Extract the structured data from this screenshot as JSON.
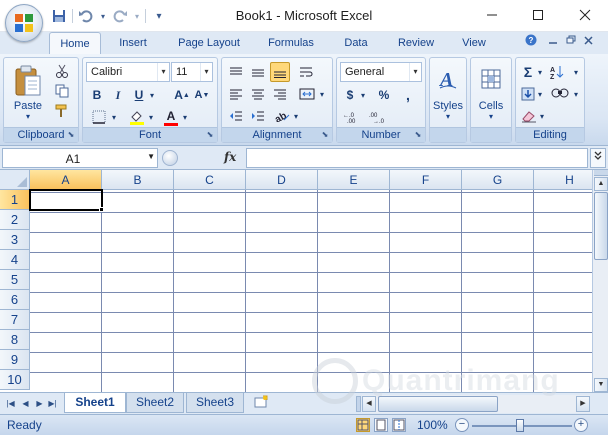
{
  "window": {
    "title": "Book1 - Microsoft Excel",
    "minimize_glyph": "—",
    "maximize_glyph": "☐",
    "close_glyph": "✕"
  },
  "quick_access": {
    "save_glyph": "💾",
    "undo_glyph": "↶",
    "redo_glyph": "↷",
    "customize_glyph": "▾"
  },
  "tabs": [
    "Home",
    "Insert",
    "Page Layout",
    "Formulas",
    "Data",
    "Review",
    "View"
  ],
  "active_tab": "Home",
  "ribbon": {
    "clipboard": {
      "label": "Clipboard",
      "paste_label": "Paste",
      "paste_arrow": "▾"
    },
    "font": {
      "label": "Font",
      "font_name": "Calibri",
      "font_size": "11",
      "bold": "B",
      "italic": "I",
      "underline": "U",
      "grow": "A",
      "shrink": "A",
      "font_color_letter": "A"
    },
    "alignment": {
      "label": "Alignment"
    },
    "number": {
      "label": "Number",
      "format": "General",
      "currency": "$",
      "percent": "%",
      "comma": ","
    },
    "styles": {
      "label": "Styles"
    },
    "cells": {
      "label": "Cells"
    },
    "editing": {
      "label": "Editing",
      "sum": "Σ"
    }
  },
  "formula_bar": {
    "name_box": "A1",
    "fx": "fx",
    "formula": ""
  },
  "columns": [
    "A",
    "B",
    "C",
    "D",
    "E",
    "F",
    "G",
    "H"
  ],
  "rows": [
    "1",
    "2",
    "3",
    "4",
    "5",
    "6",
    "7",
    "8",
    "9",
    "10"
  ],
  "selected_cell": "A1",
  "sheets": [
    "Sheet1",
    "Sheet2",
    "Sheet3"
  ],
  "active_sheet": "Sheet1",
  "status": {
    "text": "Ready",
    "zoom": "100%",
    "zoom_out": "−",
    "zoom_in": "+"
  },
  "colors": {
    "accent": "#15428b",
    "selected_header": "#f9c15d",
    "ribbon_bg": "#dbe6f4"
  },
  "watermark": {
    "text": "Quantrimang"
  }
}
